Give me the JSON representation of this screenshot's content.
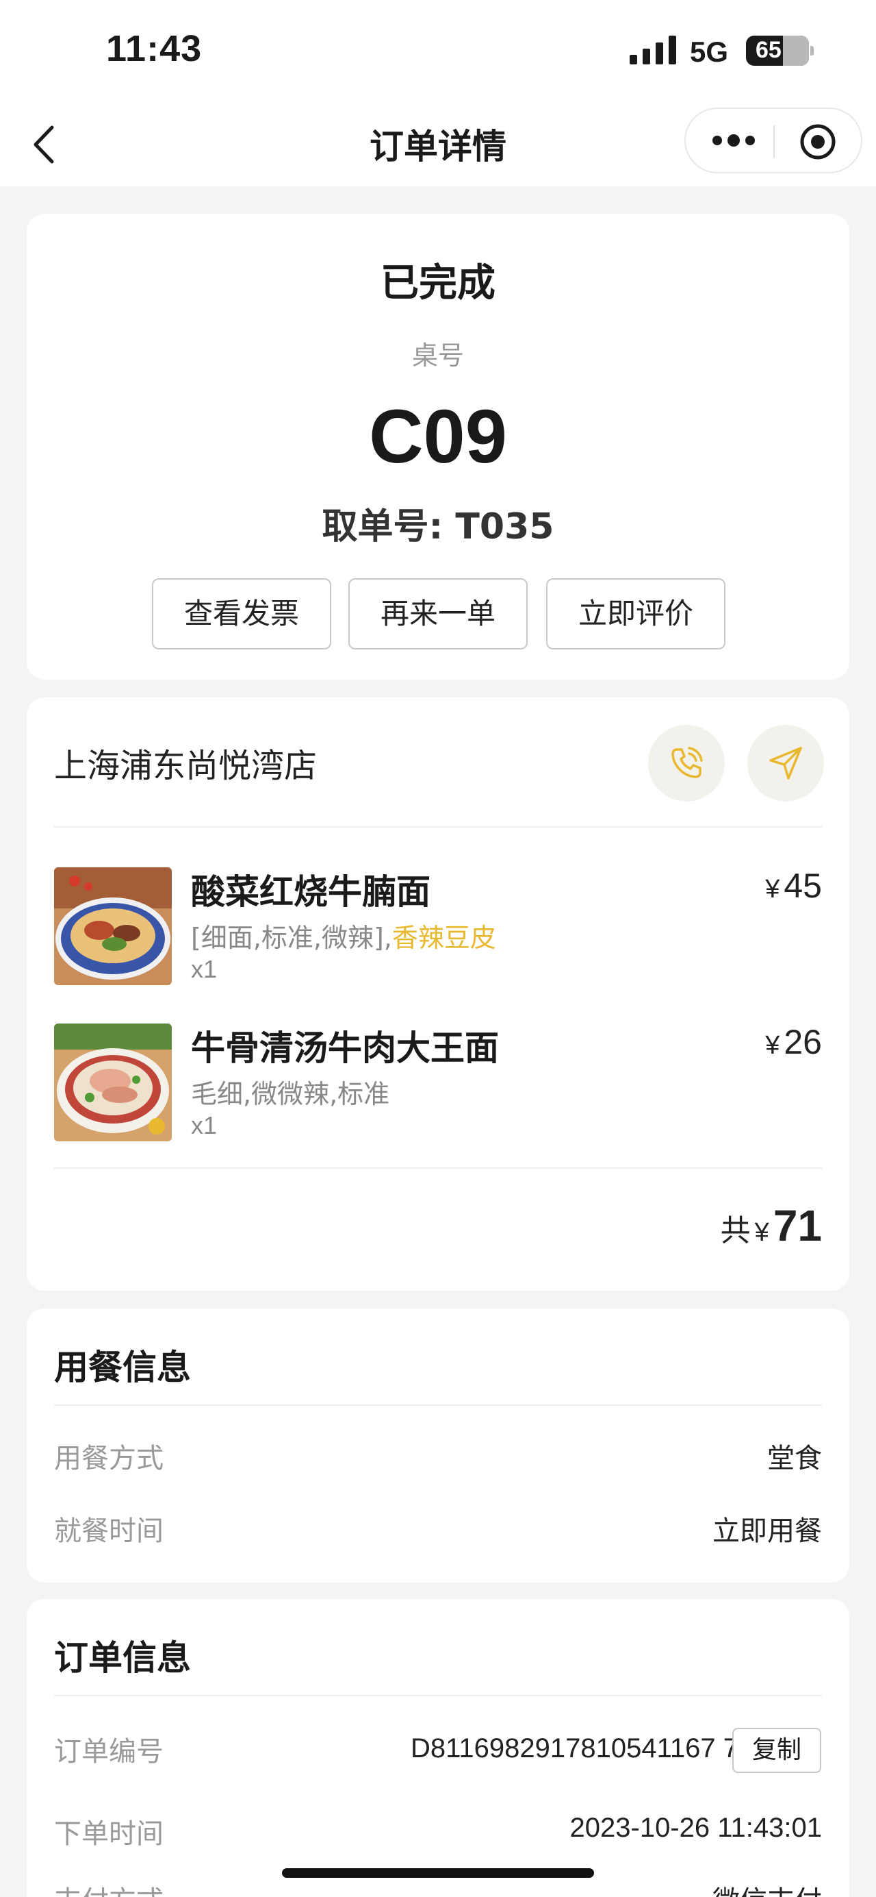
{
  "status_bar": {
    "time": "11:43",
    "network": "5G",
    "battery": "65"
  },
  "nav": {
    "title": "订单详情"
  },
  "order_status": {
    "status": "已完成",
    "table_label": "桌号",
    "table_number": "C09",
    "pickup": "取单号: T035",
    "buttons": {
      "invoice": "查看发票",
      "reorder": "再来一单",
      "review": "立即评价"
    }
  },
  "store": {
    "name": "上海浦东尚悦湾店",
    "items": [
      {
        "name": "酸菜红烧牛腩面",
        "spec": "[细面,标准,微辣],",
        "spec_highlight": "香辣豆皮",
        "qty": "x1",
        "currency": "¥",
        "price": "45"
      },
      {
        "name": "牛骨清汤牛肉大王面",
        "spec": "毛细,微微辣,标准",
        "spec_highlight": "",
        "qty": "x1",
        "currency": "¥",
        "price": "26"
      }
    ],
    "total_label": "共",
    "total_currency": "¥",
    "total_amount": "71"
  },
  "dining_info": {
    "title": "用餐信息",
    "rows": [
      {
        "label": "用餐方式",
        "value": "堂食"
      },
      {
        "label": "就餐时间",
        "value": "立即用餐"
      }
    ]
  },
  "order_info": {
    "title": "订单信息",
    "order_no_label": "订单编号",
    "order_no": "D8116982917810541167 7",
    "copy_label": "复制",
    "time_label": "下单时间",
    "time_value": "2023-10-26 11:43:01",
    "payment_label": "支付方式",
    "payment_value": "微信支付"
  },
  "colors": {
    "accent": "#e8b930",
    "background": "#f4f4f4",
    "card": "#ffffff"
  },
  "icons": [
    "back-icon",
    "more-icon",
    "target-icon",
    "phone-icon",
    "navigation-icon",
    "signal-icon",
    "battery-icon"
  ]
}
